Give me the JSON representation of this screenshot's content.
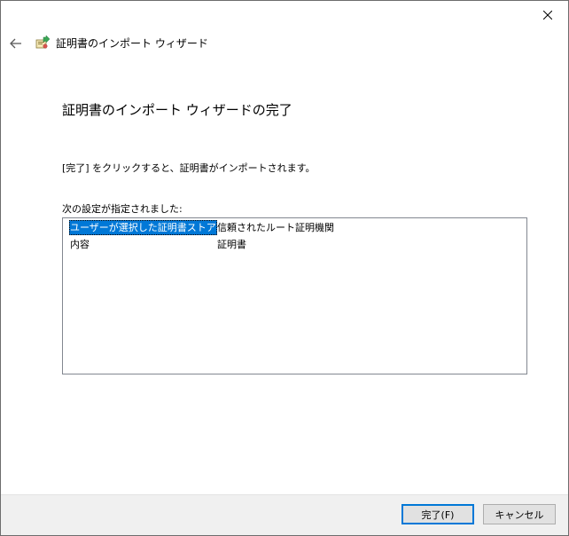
{
  "window": {
    "close_icon": "close-icon"
  },
  "header": {
    "back_icon": "back-arrow-icon",
    "wizard_icon": "certificate-wizard-icon",
    "title": "証明書のインポート ウィザード"
  },
  "main": {
    "heading": "証明書のインポート ウィザードの完了",
    "description": "[完了] をクリックすると、証明書がインポートされます。",
    "settings_label": "次の設定が指定されました:",
    "settings": [
      {
        "name": "ユーザーが選択した証明書ストア",
        "value": "信頼されたルート証明機関",
        "selected": true
      },
      {
        "name": "内容",
        "value": "証明書",
        "selected": false
      }
    ]
  },
  "footer": {
    "finish_label": "完了(F)",
    "cancel_label": "キャンセル"
  },
  "colors": {
    "selection": "#0078d7",
    "footer_bg": "#f0f0f0",
    "button_bg": "#e1e1e1"
  }
}
